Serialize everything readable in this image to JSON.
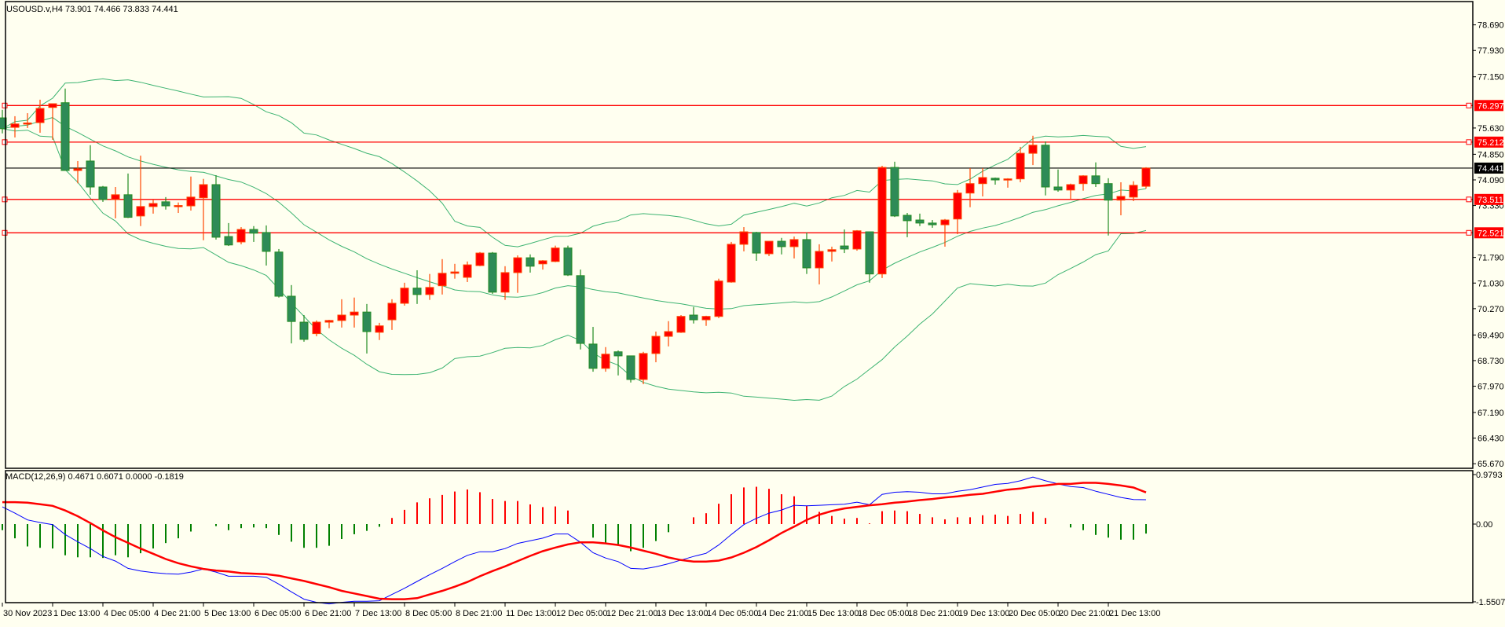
{
  "header": {
    "symbol_info": "USOUSD.v,H4  73.901 74.466 73.833 74.441"
  },
  "macd_panel": {
    "label": "MACD(12,26,9) 0.4671 0.6071 0.0000 -0.1819",
    "top_value": "0.9793",
    "zero_value": "0.00",
    "bottom_value": "-1.5507"
  },
  "colors": {
    "background": "#fffff0",
    "bull_body": "#ff0000",
    "bull_border": "#ff4500",
    "bear_body": "#2e8b57",
    "bear_border": "#228b22",
    "bands": "#3cb371",
    "level_line": "#ff0000",
    "price_line": "#000000",
    "macd_line": "#0000ff",
    "signal_line": "#ff0000",
    "hist_up": "#ff0000",
    "hist_down": "#008000"
  },
  "price_axis": [
    "78.690",
    "77.930",
    "77.150",
    "75.630",
    "74.850",
    "74.090",
    "73.330",
    "71.790",
    "71.030",
    "70.270",
    "69.490",
    "68.730",
    "67.970",
    "67.190",
    "66.430",
    "65.670"
  ],
  "levels": [
    "76.297",
    "75.212",
    "73.511",
    "72.521"
  ],
  "current_price": "74.441",
  "time_axis": [
    "30 Nov 2023",
    "1 Dec 13:00",
    "4 Dec 05:00",
    "4 Dec 21:00",
    "5 Dec 13:00",
    "6 Dec 05:00",
    "6 Dec 21:00",
    "7 Dec 13:00",
    "8 Dec 05:00",
    "8 Dec 21:00",
    "11 Dec 13:00",
    "12 Dec 05:00",
    "12 Dec 21:00",
    "13 Dec 13:00",
    "14 Dec 05:00",
    "14 Dec 21:00",
    "15 Dec 13:00",
    "18 Dec 05:00",
    "18 Dec 21:00",
    "19 Dec 13:00",
    "20 Dec 05:00",
    "20 Dec 21:00",
    "21 Dec 13:00"
  ],
  "chart_data": {
    "type": "candlestick",
    "bollinger_period": 20,
    "bollinger_dev": 2,
    "ohlc": [
      [
        75.93,
        75.61,
        76.17,
        75.47
      ],
      [
        75.65,
        75.75,
        75.98,
        75.35
      ],
      [
        75.77,
        75.78,
        76.07,
        75.63
      ],
      [
        75.79,
        76.21,
        76.47,
        75.49
      ],
      [
        76.24,
        76.35,
        76.35,
        75.28
      ],
      [
        76.38,
        74.37,
        76.8,
        74.37
      ],
      [
        74.37,
        74.42,
        74.65,
        73.99
      ],
      [
        74.65,
        73.88,
        75.12,
        73.65
      ],
      [
        73.88,
        73.51,
        73.91,
        73.44
      ],
      [
        73.51,
        73.65,
        73.88,
        72.95
      ],
      [
        73.65,
        72.98,
        74.28,
        72.96
      ],
      [
        73.02,
        73.3,
        74.81,
        72.72
      ],
      [
        73.3,
        73.39,
        73.51,
        73.09
      ],
      [
        73.44,
        73.32,
        73.58,
        73.21
      ],
      [
        73.32,
        73.33,
        73.42,
        73.11
      ],
      [
        73.32,
        73.58,
        74.19,
        73.18
      ],
      [
        73.56,
        73.95,
        74.12,
        72.3
      ],
      [
        73.95,
        72.39,
        74.23,
        72.32
      ],
      [
        72.41,
        72.16,
        72.81,
        72.13
      ],
      [
        72.25,
        72.62,
        72.69,
        72.18
      ],
      [
        72.62,
        72.51,
        72.72,
        72.25
      ],
      [
        72.53,
        71.97,
        72.74,
        71.55
      ],
      [
        71.95,
        70.64,
        72.04,
        70.6
      ],
      [
        70.64,
        69.89,
        70.97,
        69.24
      ],
      [
        69.87,
        69.36,
        70.08,
        69.29
      ],
      [
        69.53,
        69.87,
        69.92,
        69.45
      ],
      [
        69.87,
        69.92,
        69.94,
        69.69
      ],
      [
        69.92,
        70.08,
        70.55,
        69.71
      ],
      [
        70.08,
        70.17,
        70.6,
        69.71
      ],
      [
        70.17,
        69.59,
        70.41,
        68.94
      ],
      [
        69.57,
        69.76,
        69.85,
        69.34
      ],
      [
        69.94,
        70.43,
        70.55,
        69.64
      ],
      [
        70.43,
        70.88,
        71.04,
        70.36
      ],
      [
        70.88,
        70.69,
        71.41,
        70.41
      ],
      [
        70.69,
        70.9,
        71.3,
        70.53
      ],
      [
        70.95,
        71.32,
        71.74,
        70.69
      ],
      [
        71.32,
        71.36,
        71.6,
        71.16
      ],
      [
        71.2,
        71.57,
        71.67,
        71.06
      ],
      [
        71.55,
        71.92,
        71.95,
        71.53
      ],
      [
        71.92,
        70.76,
        71.95,
        70.71
      ],
      [
        70.76,
        71.34,
        71.53,
        70.53
      ],
      [
        71.34,
        71.78,
        71.85,
        70.74
      ],
      [
        71.78,
        71.53,
        71.88,
        71.34
      ],
      [
        71.6,
        71.69,
        71.71,
        71.43
      ],
      [
        71.67,
        72.07,
        72.14,
        71.65
      ],
      [
        72.07,
        71.27,
        72.14,
        71.24
      ],
      [
        71.25,
        69.24,
        71.43,
        69.06
      ],
      [
        69.22,
        68.5,
        69.73,
        68.4
      ],
      [
        68.5,
        68.92,
        69.13,
        68.4
      ],
      [
        68.99,
        68.87,
        69.03,
        68.29
      ],
      [
        68.87,
        68.17,
        68.87,
        68.08
      ],
      [
        68.17,
        68.94,
        68.99,
        68.03
      ],
      [
        68.94,
        69.45,
        69.59,
        68.68
      ],
      [
        69.45,
        69.59,
        69.9,
        69.15
      ],
      [
        69.57,
        70.04,
        70.08,
        69.55
      ],
      [
        70.08,
        69.94,
        70.32,
        69.83
      ],
      [
        69.94,
        70.04,
        70.06,
        69.76
      ],
      [
        70.04,
        71.09,
        71.16,
        69.99
      ],
      [
        71.06,
        72.18,
        72.25,
        71.04
      ],
      [
        72.18,
        72.55,
        72.69,
        71.97
      ],
      [
        72.53,
        71.92,
        72.55,
        71.69
      ],
      [
        71.9,
        72.27,
        72.27,
        71.83
      ],
      [
        72.27,
        72.11,
        72.37,
        71.88
      ],
      [
        72.11,
        72.32,
        72.41,
        71.76
      ],
      [
        72.32,
        71.48,
        72.53,
        71.3
      ],
      [
        71.48,
        71.97,
        72.18,
        70.99
      ],
      [
        71.97,
        72.02,
        72.11,
        71.67
      ],
      [
        72.13,
        72.04,
        72.62,
        71.92
      ],
      [
        72.04,
        72.58,
        72.6,
        71.99
      ],
      [
        72.55,
        71.3,
        72.55,
        71.04
      ],
      [
        71.3,
        74.46,
        74.51,
        71.18
      ],
      [
        74.46,
        73.02,
        74.63,
        72.99
      ],
      [
        73.04,
        72.88,
        73.11,
        72.39
      ],
      [
        72.9,
        72.81,
        73.09,
        72.72
      ],
      [
        72.81,
        72.76,
        72.9,
        72.67
      ],
      [
        72.76,
        72.9,
        72.93,
        72.11
      ],
      [
        72.93,
        73.7,
        73.79,
        72.48
      ],
      [
        73.7,
        73.98,
        74.44,
        73.28
      ],
      [
        73.98,
        74.16,
        74.44,
        73.6
      ],
      [
        74.14,
        74.09,
        74.16,
        73.95
      ],
      [
        74.09,
        74.12,
        74.14,
        73.86
      ],
      [
        74.12,
        74.88,
        75.07,
        74.02
      ],
      [
        74.88,
        75.12,
        75.4,
        74.53
      ],
      [
        75.12,
        73.88,
        75.23,
        73.63
      ],
      [
        73.88,
        73.79,
        74.4,
        73.74
      ],
      [
        73.79,
        73.95,
        73.98,
        73.51
      ],
      [
        73.98,
        74.21,
        74.23,
        73.77
      ],
      [
        74.21,
        73.98,
        74.61,
        73.88
      ],
      [
        73.98,
        73.49,
        74.14,
        72.44
      ],
      [
        73.49,
        73.6,
        74.02,
        73.04
      ],
      [
        73.58,
        73.93,
        74.05,
        73.46
      ],
      [
        73.901,
        74.441,
        74.466,
        73.833
      ]
    ],
    "macd": [
      0.33,
      0.21,
      0.08,
      0.03,
      -0.01,
      -0.2,
      -0.34,
      -0.47,
      -0.62,
      -0.71,
      -0.85,
      -0.9,
      -0.93,
      -0.95,
      -0.96,
      -0.92,
      -0.86,
      -0.92,
      -1.0,
      -1.0,
      -1.0,
      -1.02,
      -1.15,
      -1.3,
      -1.44,
      -1.5,
      -1.53,
      -1.5,
      -1.48,
      -1.48,
      -1.47,
      -1.35,
      -1.23,
      -1.1,
      -0.97,
      -0.85,
      -0.72,
      -0.6,
      -0.53,
      -0.53,
      -0.47,
      -0.37,
      -0.32,
      -0.27,
      -0.19,
      -0.19,
      -0.35,
      -0.55,
      -0.65,
      -0.72,
      -0.85,
      -0.86,
      -0.82,
      -0.76,
      -0.69,
      -0.62,
      -0.56,
      -0.4,
      -0.2,
      -0.01,
      0.11,
      0.21,
      0.27,
      0.36,
      0.35,
      0.36,
      0.37,
      0.38,
      0.42,
      0.37,
      0.57,
      0.61,
      0.62,
      0.61,
      0.58,
      0.58,
      0.63,
      0.66,
      0.71,
      0.76,
      0.78,
      0.83,
      0.9,
      0.83,
      0.77,
      0.72,
      0.7,
      0.63,
      0.57,
      0.51,
      0.47,
      0.4671
    ],
    "signal": [
      0.42,
      0.42,
      0.41,
      0.38,
      0.35,
      0.26,
      0.15,
      0.02,
      -0.12,
      -0.25,
      -0.36,
      -0.47,
      -0.57,
      -0.67,
      -0.75,
      -0.81,
      -0.86,
      -0.89,
      -0.91,
      -0.94,
      -0.95,
      -0.96,
      -0.99,
      -1.04,
      -1.09,
      -1.15,
      -1.21,
      -1.28,
      -1.33,
      -1.38,
      -1.43,
      -1.44,
      -1.44,
      -1.42,
      -1.35,
      -1.28,
      -1.2,
      -1.11,
      -1.0,
      -0.9,
      -0.81,
      -0.71,
      -0.61,
      -0.52,
      -0.45,
      -0.39,
      -0.35,
      -0.35,
      -0.37,
      -0.4,
      -0.45,
      -0.51,
      -0.57,
      -0.64,
      -0.69,
      -0.72,
      -0.72,
      -0.7,
      -0.64,
      -0.55,
      -0.44,
      -0.31,
      -0.17,
      -0.05,
      0.08,
      0.18,
      0.25,
      0.3,
      0.33,
      0.36,
      0.38,
      0.41,
      0.43,
      0.46,
      0.48,
      0.51,
      0.53,
      0.56,
      0.58,
      0.62,
      0.66,
      0.68,
      0.72,
      0.74,
      0.77,
      0.77,
      0.79,
      0.79,
      0.77,
      0.74,
      0.7,
      0.6071
    ],
    "histogram_scale": 1.3,
    "macd_range": [
      -1.5507,
      0.9793
    ]
  }
}
